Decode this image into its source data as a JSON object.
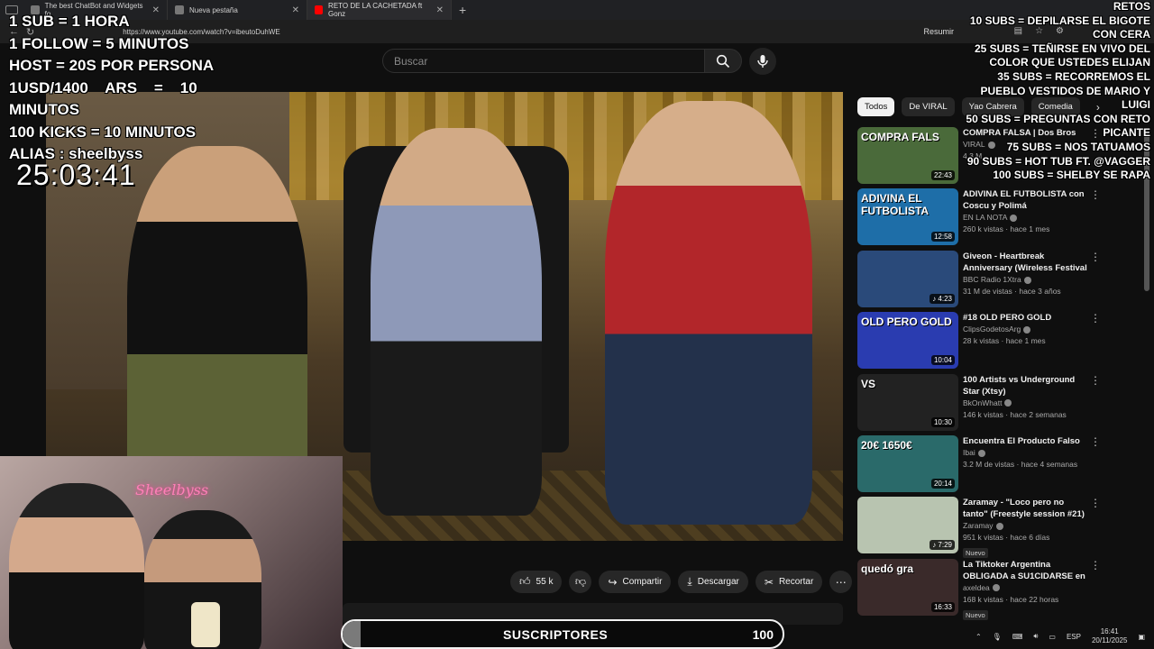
{
  "browser": {
    "tabs": [
      {
        "title": "The best ChatBot and Widgets fo"
      },
      {
        "title": "Nueva pestaña"
      },
      {
        "title": "RETO DE LA CACHETADA ft Gonz"
      }
    ],
    "url": "https://www.youtube.com/watch?v=ibeutoDuhWE",
    "summarize_label": "Resumir"
  },
  "youtube": {
    "search_placeholder": "Buscar",
    "actions": {
      "likes": "55 k",
      "share": "Compartir",
      "download": "Descargar",
      "clip": "Recortar"
    },
    "chips": [
      "Todos",
      "De VIRAL",
      "Yao Cabrera",
      "Comedia"
    ],
    "recommendations": [
      {
        "title": "COMPRA FALSA | Dos Bros",
        "channel": "VIRAL",
        "views": "4.3 M",
        "duration": "22:43",
        "thumb_text": "COMPRA FALS",
        "badge": ""
      },
      {
        "title": "ADIVINA EL FUTBOLISTA con Coscu y Polimá",
        "channel": "EN LA NOTA",
        "views": "260 k vistas · hace 1 mes",
        "duration": "12:58",
        "thumb_text": "ADIVINA EL FUTBOLISTA",
        "badge": ""
      },
      {
        "title": "Giveon - Heartbreak Anniversary (Wireless Festival ...",
        "channel": "BBC Radio 1Xtra",
        "views": "31 M de vistas · hace 3 años",
        "duration": "♪ 4:23",
        "thumb_text": "",
        "badge": ""
      },
      {
        "title": "#18 OLD PERO GOLD",
        "channel": "ClipsGodetosArg",
        "views": "28 k vistas · hace 1 mes",
        "duration": "10:04",
        "thumb_text": "OLD PERO GOLD",
        "badge": ""
      },
      {
        "title": "100 Artists vs Underground Star (Xtsy)",
        "channel": "BkOnWhatt",
        "views": "146 k vistas · hace 2 semanas",
        "duration": "10:30",
        "thumb_text": "VS",
        "badge": ""
      },
      {
        "title": "Encuentra El Producto Falso",
        "channel": "Ibai",
        "views": "3.2 M de vistas · hace 4 semanas",
        "duration": "20:14",
        "thumb_text": "20€   1650€",
        "badge": ""
      },
      {
        "title": "Zaramay - \"Loco pero no tanto\" (Freestyle session #21)",
        "channel": "Zaramay",
        "views": "951 k vistas · hace 6 días",
        "duration": "♪ 7:29",
        "thumb_text": "",
        "badge": "Nuevo"
      },
      {
        "title": "La Tiktoker Argentina OBLIGADA a SU1CIDARSE en ...",
        "channel": "axeldea",
        "views": "168 k vistas · hace 22 horas",
        "duration": "16:33",
        "thumb_text": "quedó gra",
        "badge": "Nuevo"
      }
    ]
  },
  "stream": {
    "left_overlay": [
      "1 SUB = 1 HORA",
      "1 FOLLOW = 5 MINUTOS",
      "HOST = 20S POR PERSONA",
      "1USD/1400    ARS    =    10",
      "MINUTOS",
      "100 KICKS = 10 MINUTOS",
      "ALIAS : sheelbyss"
    ],
    "timer": "25:03:41",
    "right_overlay": [
      "RETOS",
      "10 SUBS = DEPILARSE EL BIGOTE",
      "CON CERA",
      "25 SUBS = TEÑIRSE EN VIVO DEL",
      "COLOR QUE USTEDES ELIJAN",
      "35 SUBS = RECORREMOS EL",
      "PUEBLO VESTIDOS DE MARIO Y",
      "LUIGI",
      "50 SUBS = PREGUNTAS CON RETO",
      "PICANTE",
      "75 SUBS = NOS TATUAMOS",
      "90 SUBS = HOT TUB FT. @VAGGER",
      "100 SUBS = SHELBY SE RAPA"
    ],
    "cam_sign": "Sheelbyss",
    "sub_goal": {
      "label": "SUSCRIPTORES",
      "goal": "100",
      "progress": 0.04
    }
  },
  "taskbar": {
    "lang": "ESP",
    "time": "16:41",
    "date": "20/11/2025"
  },
  "colors": {
    "accent": "#ff0000",
    "bg": "#0f0f0f",
    "chip_active": "#f1f1f1"
  }
}
